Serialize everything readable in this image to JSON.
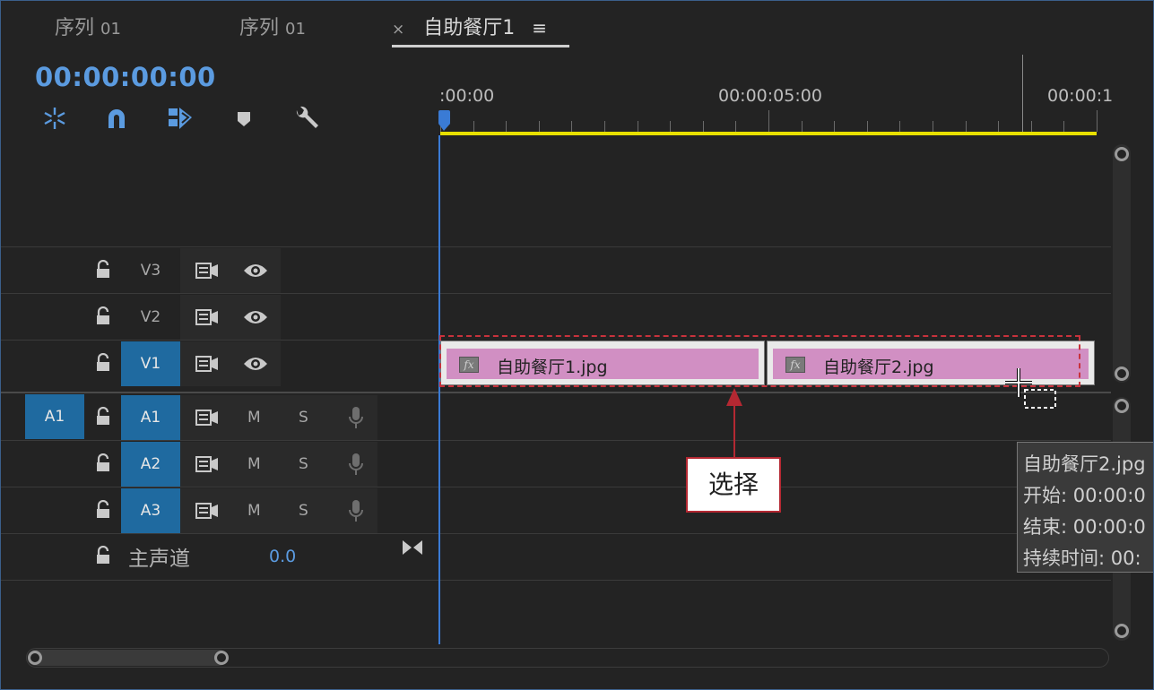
{
  "tabs": [
    {
      "label": "序列",
      "num": "01"
    },
    {
      "label": "序列",
      "num": "01"
    },
    {
      "close": "×",
      "label": "自助餐厅1",
      "menu": "≡"
    }
  ],
  "timecode": "00:00:00:00",
  "ruler": {
    "labels": [
      ":00:00",
      "00:00:05:00",
      "00:00:1"
    ]
  },
  "video_tracks": [
    {
      "name": "V3",
      "active": false
    },
    {
      "name": "V2",
      "active": false
    },
    {
      "name": "V1",
      "active": true
    }
  ],
  "audio_tracks": [
    {
      "source": "A1",
      "name": "A1",
      "m": "M",
      "s": "S"
    },
    {
      "name": "A2",
      "m": "M",
      "s": "S"
    },
    {
      "name": "A3",
      "m": "M",
      "s": "S"
    }
  ],
  "master": {
    "label": "主声道",
    "value": "0.0"
  },
  "clips": [
    {
      "fx": "fx",
      "label": "自助餐厅1.jpg"
    },
    {
      "fx": "fx",
      "label": "自助餐厅2.jpg"
    }
  ],
  "callout": "选择",
  "tooltip": {
    "name": "自助餐厅2.jpg",
    "start": "开始: 00:00:0",
    "end": "结束: 00:00:0",
    "duration": "持续时间: 00:"
  },
  "colors": {
    "accent": "#5b9be0",
    "track_active": "#1f6aa0",
    "clip": "#d18fc3",
    "work_area": "#e8e000",
    "annotation": "#b42832"
  }
}
